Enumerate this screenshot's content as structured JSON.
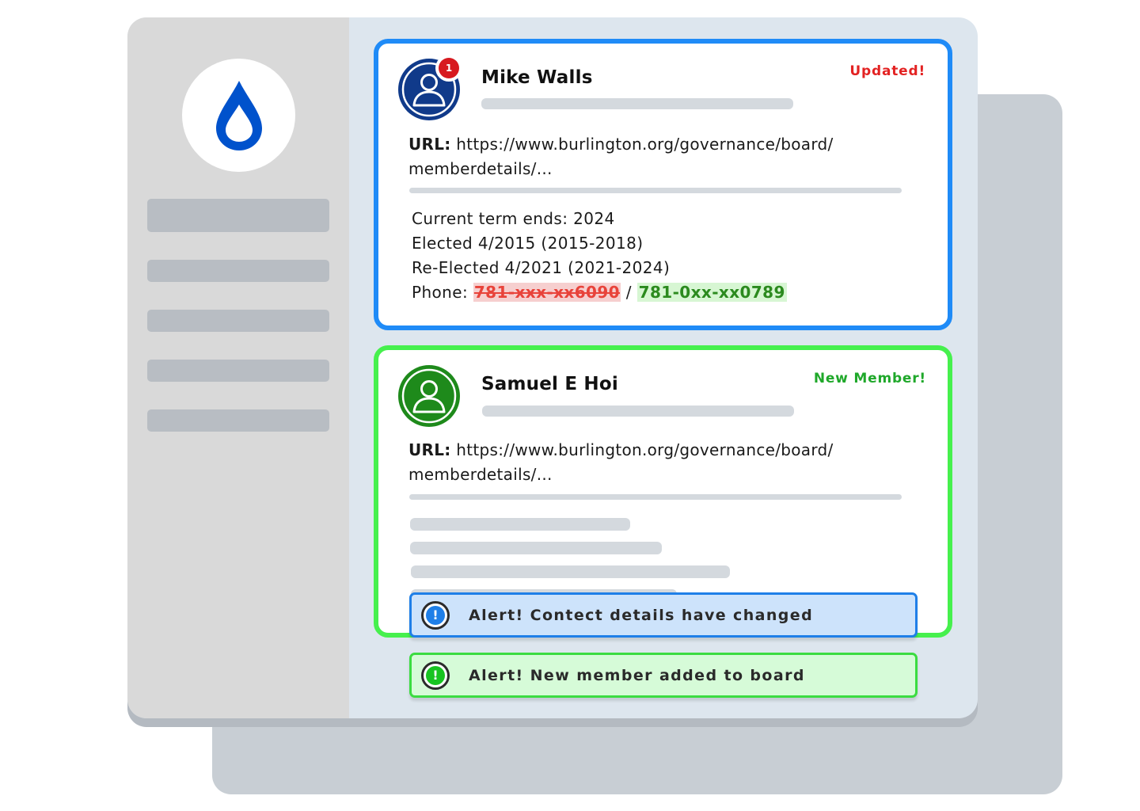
{
  "app": {
    "logo_icon": "water-drop-icon",
    "brand_color": "#0052cc"
  },
  "sidebar": {
    "item_count": 5
  },
  "cards": [
    {
      "name": "Mike Walls",
      "status": "Updated!",
      "status_color": "#e32222",
      "badge_count": "1",
      "url_label": "URL:",
      "url_line1": "https://www.burlington.org/governance/board/",
      "url_line2": "memberdetails/...",
      "details": {
        "term": "Current term ends: 2024",
        "elected": "Elected 4/2015 (2015-2018)",
        "reelected": "Re-Elected 4/2021 (2021-2024)",
        "phone_label": "Phone:",
        "phone_old": "781-xxx-xx6090",
        "phone_separator": "/",
        "phone_new": "781-0xx-xx0789"
      }
    },
    {
      "name": "Samuel E Hoi",
      "status": "New Member!",
      "status_color": "#1fa82a",
      "url_label": "URL:",
      "url_line1": "https://www.burlington.org/governance/board/",
      "url_line2": "memberdetails/..."
    }
  ],
  "alerts": [
    {
      "text": "Alert! Contect details have changed",
      "icon": "exclamation-icon",
      "color": "#1f7fe8",
      "icon_glyph": "!"
    },
    {
      "text": "Alert! New member added to board",
      "icon": "exclamation-icon",
      "color": "#18c421",
      "icon_glyph": "!"
    }
  ]
}
